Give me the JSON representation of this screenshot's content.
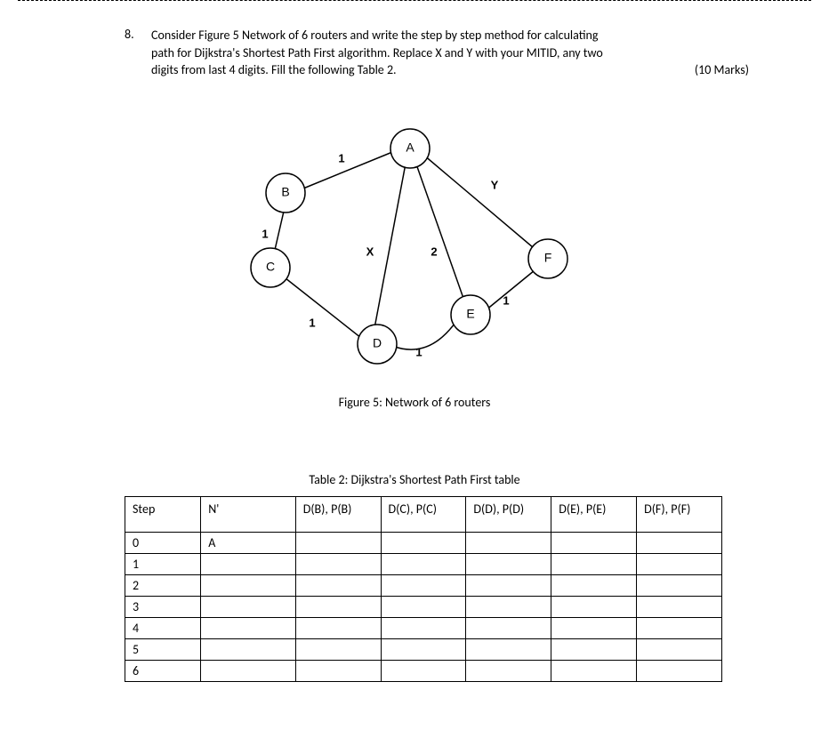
{
  "question": {
    "number": "8.",
    "text_line1": "Consider Figure 5 Network of 6 routers and write the step by step method for calculating",
    "text_line2": "path for Dijkstra's Shortest Path First algorithm. Replace X and Y with your MITID, any two",
    "text_line3": "digits from last 4 digits. Fill the following Table 2.",
    "marks": "(10 Marks)"
  },
  "figure": {
    "caption": "Figure 5: Network of 6 routers",
    "nodes": {
      "A": "A",
      "B": "B",
      "C": "C",
      "D": "D",
      "E": "E",
      "F": "F"
    },
    "edge_labels": {
      "AB": "1",
      "BC": "1",
      "CD": "1",
      "AD": "X",
      "AE": "2",
      "AF": "Y",
      "DE": "1",
      "EF": "1"
    }
  },
  "table": {
    "caption": "Table 2: Dijkstra's Shortest Path First table",
    "headers": {
      "step": "Step",
      "n": "N'",
      "db": "D(B), P(B)",
      "dc": "D(C), P(C)",
      "dd": "D(D), P(D)",
      "de": "D(E), P(E)",
      "df": "D(F), P(F)"
    },
    "rows": [
      {
        "step": "0",
        "n": "A",
        "db": "",
        "dc": "",
        "dd": "",
        "de": "",
        "df": ""
      },
      {
        "step": "1",
        "n": "",
        "db": "",
        "dc": "",
        "dd": "",
        "de": "",
        "df": ""
      },
      {
        "step": "2",
        "n": "",
        "db": "",
        "dc": "",
        "dd": "",
        "de": "",
        "df": ""
      },
      {
        "step": "3",
        "n": "",
        "db": "",
        "dc": "",
        "dd": "",
        "de": "",
        "df": ""
      },
      {
        "step": "4",
        "n": "",
        "db": "",
        "dc": "",
        "dd": "",
        "de": "",
        "df": ""
      },
      {
        "step": "5",
        "n": "",
        "db": "",
        "dc": "",
        "dd": "",
        "de": "",
        "df": ""
      },
      {
        "step": "6",
        "n": "",
        "db": "",
        "dc": "",
        "dd": "",
        "de": "",
        "df": ""
      }
    ]
  }
}
